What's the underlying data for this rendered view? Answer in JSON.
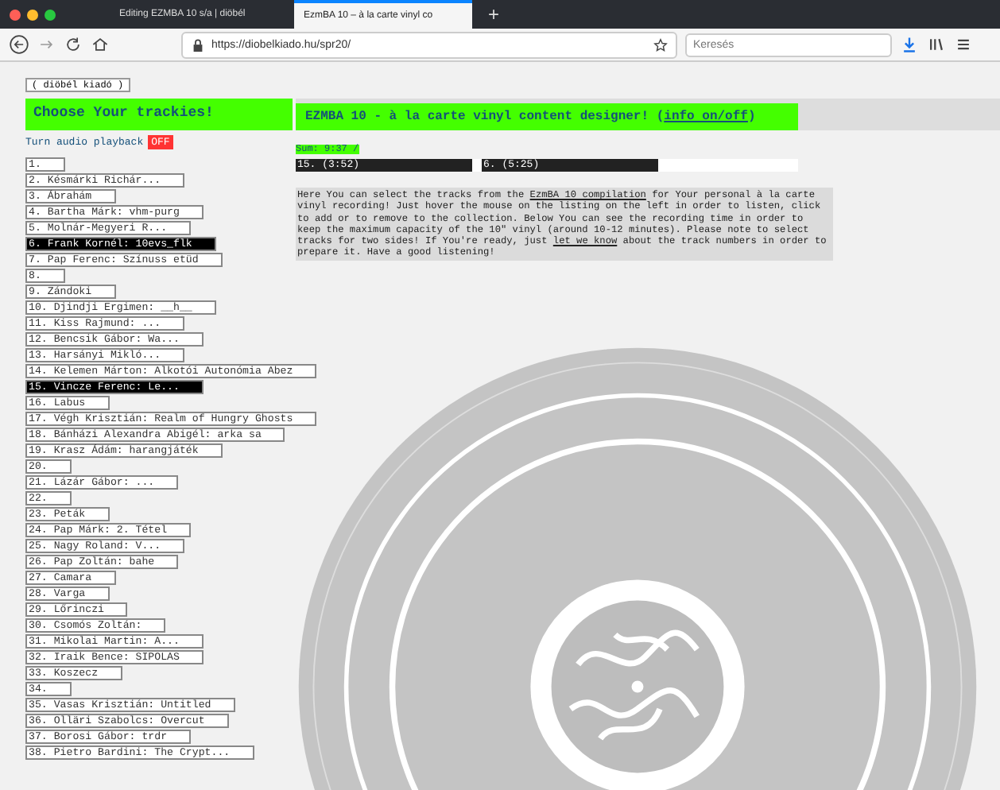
{
  "browser": {
    "tabs": [
      {
        "label": "Editing EZMBA 10 s/a | diöbél",
        "selected": false
      },
      {
        "label": "EzmBA 10 – à la carte vinyl co",
        "selected": true
      }
    ],
    "new_tab": "+",
    "url": "https://diobelkiado.hu/spr20/",
    "search": {
      "placeholder": "Keresés"
    }
  },
  "breadcrumb": "( diöbél kiadó )",
  "left": {
    "title": "Choose Your trackies!",
    "audio_label": "Turn audio playback",
    "audio_toggle": {
      "label": "OFF",
      "on": false
    },
    "tracks": [
      {
        "label": "1.",
        "selected": false
      },
      {
        "label": "2. Késmárki Richár...",
        "selected": false
      },
      {
        "label": "3. Ábrahám",
        "selected": false
      },
      {
        "label": "4. Bartha Márk: vhm-purg",
        "selected": false
      },
      {
        "label": "5. Molnár-Megyeri R...",
        "selected": false
      },
      {
        "label": "6. Frank Kornél: 10evs_flk",
        "selected": true
      },
      {
        "label": "7. Pap Ferenc: Színuss etüd",
        "selected": false
      },
      {
        "label": "8.",
        "selected": false
      },
      {
        "label": "9. Zándoki",
        "selected": false
      },
      {
        "label": "10. Djindji Ergimen: __h__",
        "selected": false
      },
      {
        "label": "11. Kiss Rajmund: ...",
        "selected": false
      },
      {
        "label": "12. Bencsik Gábor: Wa...",
        "selected": false
      },
      {
        "label": "13. Harsányi Mikló...",
        "selected": false
      },
      {
        "label": "14. Kelemen Márton: Alkotói Autonómia Abez",
        "selected": false
      },
      {
        "label": "15. Vincze Ferenc: Le...",
        "selected": true
      },
      {
        "label": "16. Labus",
        "selected": false
      },
      {
        "label": "17. Végh Krisztián: Realm of Hungry Ghosts",
        "selected": false
      },
      {
        "label": "18. Bánházi Alexandra Abigél: arka sa",
        "selected": false
      },
      {
        "label": "19. Krasz Ádám: harangjáték",
        "selected": false
      },
      {
        "label": "20.",
        "selected": false
      },
      {
        "label": "21. Lázár Gábor: ...",
        "selected": false
      },
      {
        "label": "22.",
        "selected": false
      },
      {
        "label": "23. Peták",
        "selected": false
      },
      {
        "label": "24. Pap Márk: 2. Tétel",
        "selected": false
      },
      {
        "label": "25. Nagy Roland: V...",
        "selected": false
      },
      {
        "label": "26. Pap Zoltán: bahe",
        "selected": false
      },
      {
        "label": "27. Camara",
        "selected": false
      },
      {
        "label": "28. Varga",
        "selected": false
      },
      {
        "label": "29. Lőrinczi",
        "selected": false
      },
      {
        "label": "30. Csomós Zoltán:",
        "selected": false
      },
      {
        "label": "31. Mikolai Martin: A...",
        "selected": false
      },
      {
        "label": "32. Iraik Bence: SIPOLAS",
        "selected": false
      },
      {
        "label": "33. Koszecz",
        "selected": false
      },
      {
        "label": "34.",
        "selected": false
      },
      {
        "label": "35. Vasas Krisztián: Untitled",
        "selected": false
      },
      {
        "label": "36. Olläri Szabolcs: Overcut",
        "selected": false
      },
      {
        "label": "37. Borosi Gábor: trdr",
        "selected": false
      },
      {
        "label": "38. Pietro Bardini: The Crypt...",
        "selected": false
      }
    ]
  },
  "right": {
    "title": "EZMBA 10 - à la carte vinyl content designer! (",
    "info_link": "info on/off",
    "title_end": ")",
    "sum": "Sum: 9:37 /",
    "slots": [
      {
        "label": "15. (3:52)"
      },
      {
        "label": "6. (5:25)"
      }
    ],
    "description_parts": [
      {
        "kind": "text",
        "text": "Here You can select the tracks from the "
      },
      {
        "kind": "link",
        "text": "EzmBA 10 compilation"
      },
      {
        "kind": "text",
        "text": " for Your personal à la carte vinyl recording! Just hover the mouse on the listing on the left in order to listen, click to add or to remove to the collection. Below You can see the recording time in order to keep the maximum capacity of the 10\" vinyl (around 10-12 minutes). Please note to select tracks for two sides! If You're ready, just "
      },
      {
        "kind": "link",
        "text": "let we know"
      },
      {
        "kind": "text",
        "text": " about the track numbers in order to prepare it. Have a good listening!"
      }
    ]
  }
}
